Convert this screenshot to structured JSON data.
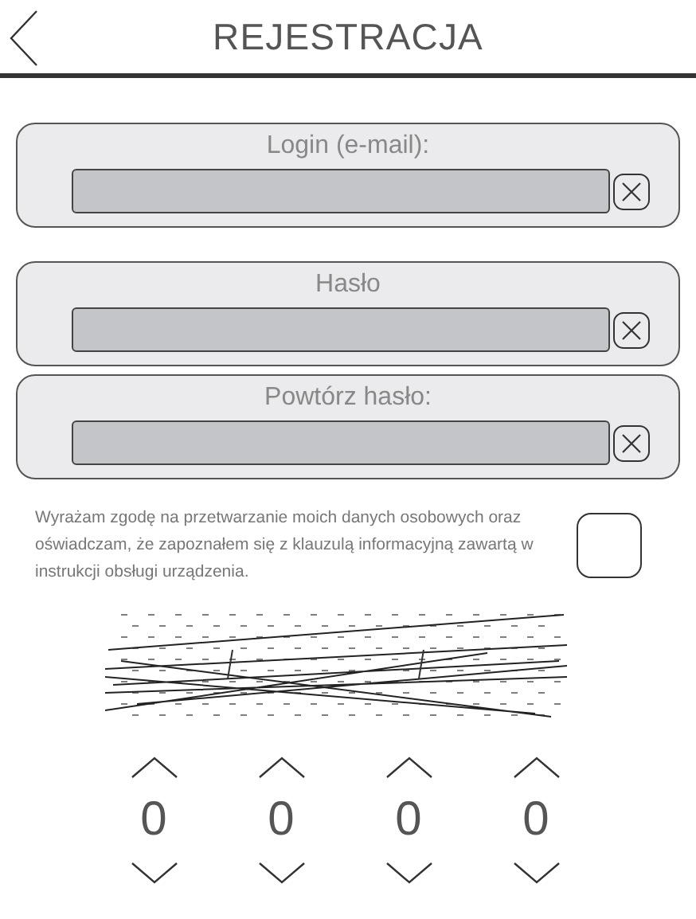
{
  "header": {
    "title": "REJESTRACJA"
  },
  "fields": [
    {
      "label": "Login (e-mail):"
    },
    {
      "label": "Hasło"
    },
    {
      "label": "Powtórz hasło:"
    }
  ],
  "consent": {
    "text": "Wyrażam zgodę na przetwarzanie moich danych osobowych oraz oświadczam, że zapoznałem się z klauzulą informacyjną zawartą w instrukcji obsługi urządzenia.",
    "checked": false
  },
  "digits": [
    {
      "value": "0"
    },
    {
      "value": "0"
    },
    {
      "value": "0"
    },
    {
      "value": "0"
    }
  ]
}
